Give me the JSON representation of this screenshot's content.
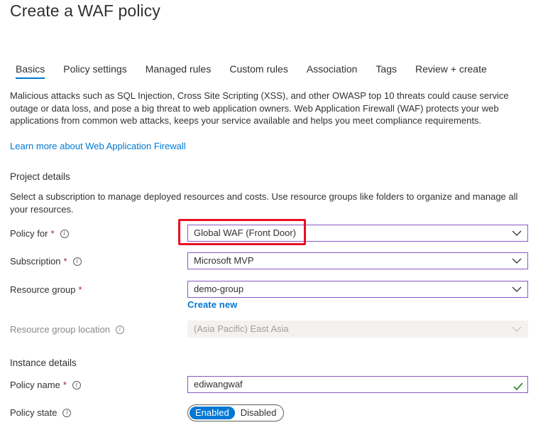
{
  "page": {
    "title": "Create a WAF policy"
  },
  "tabs": [
    {
      "label": "Basics",
      "active": true
    },
    {
      "label": "Policy settings"
    },
    {
      "label": "Managed rules"
    },
    {
      "label": "Custom rules"
    },
    {
      "label": "Association"
    },
    {
      "label": "Tags"
    },
    {
      "label": "Review + create"
    }
  ],
  "intro": {
    "description": "Malicious attacks such as SQL Injection, Cross Site Scripting (XSS), and other OWASP top 10 threats could cause service outage or data loss, and pose a big threat to web application owners. Web Application Firewall (WAF) protects your web applications from common web attacks, keeps your service available and helps you meet compliance requirements.",
    "learn_more": "Learn more about Web Application Firewall"
  },
  "project": {
    "heading": "Project details",
    "description": "Select a subscription to manage deployed resources and costs. Use resource groups like folders to organize and manage all your resources.",
    "policy_for": {
      "label": "Policy for",
      "required": "*",
      "value": "Global WAF (Front Door)"
    },
    "subscription": {
      "label": "Subscription",
      "required": "*",
      "value": "Microsoft MVP"
    },
    "resource_group": {
      "label": "Resource group",
      "required": "*",
      "value": "demo-group",
      "create_new": "Create new"
    },
    "resource_group_location": {
      "label": "Resource group location",
      "value": "(Asia Pacific) East Asia"
    }
  },
  "instance": {
    "heading": "Instance details",
    "policy_name": {
      "label": "Policy name",
      "required": "*",
      "value": "ediwangwaf"
    },
    "policy_state": {
      "label": "Policy state",
      "on_label": "Enabled",
      "off_label": "Disabled",
      "selected": "Enabled"
    }
  },
  "colors": {
    "accent": "#0078d4",
    "input_border": "#8a56c2",
    "highlight": "#e81123",
    "valid": "#107c10"
  },
  "icons": {
    "info": "info-icon",
    "chevron": "chevron-down-icon",
    "check": "checkmark-icon"
  }
}
